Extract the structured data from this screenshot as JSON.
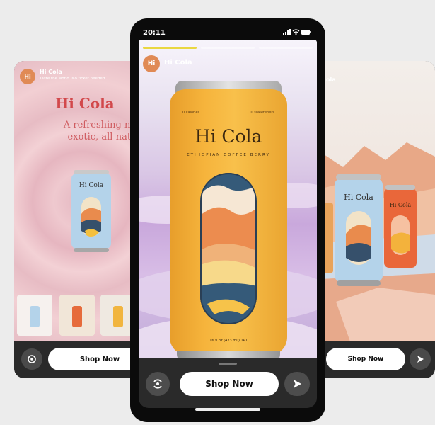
{
  "center_story": {
    "status_time": "20:11",
    "brand_name": "Hi Cola",
    "avatar_text": "Hi",
    "can": {
      "calories": "0 calories",
      "sweeteners": "0 sweeteners",
      "brand": "Hi Cola",
      "flavor": "ETHIOPIAN COFFEE BERRY",
      "volume": "16 fl oz (473 mL) 1PT"
    },
    "shop_label": "Shop Now",
    "progress": [
      1,
      0,
      0
    ]
  },
  "left_story": {
    "avatar_text": "Hi",
    "brand_name": "Hi Cola",
    "tagline": "Taste the world. No ticket needed",
    "title": "Hi Cola",
    "headline_line1": "A refreshing new sod",
    "headline_line2": "exotic, all-natural fl",
    "shop_label": "Shop Now"
  },
  "right_story": {
    "brand_name_partial": "ola",
    "shop_label": "Shop Now"
  },
  "icons": {
    "camera": "camera-flip-icon",
    "send": "send-arrow-icon",
    "signal": "signal-icon",
    "wifi": "wifi-icon",
    "battery": "battery-icon"
  },
  "colors": {
    "accent_yellow": "#e9d742",
    "can_orange": "#f6b43c",
    "brand_red": "#d2484b"
  }
}
